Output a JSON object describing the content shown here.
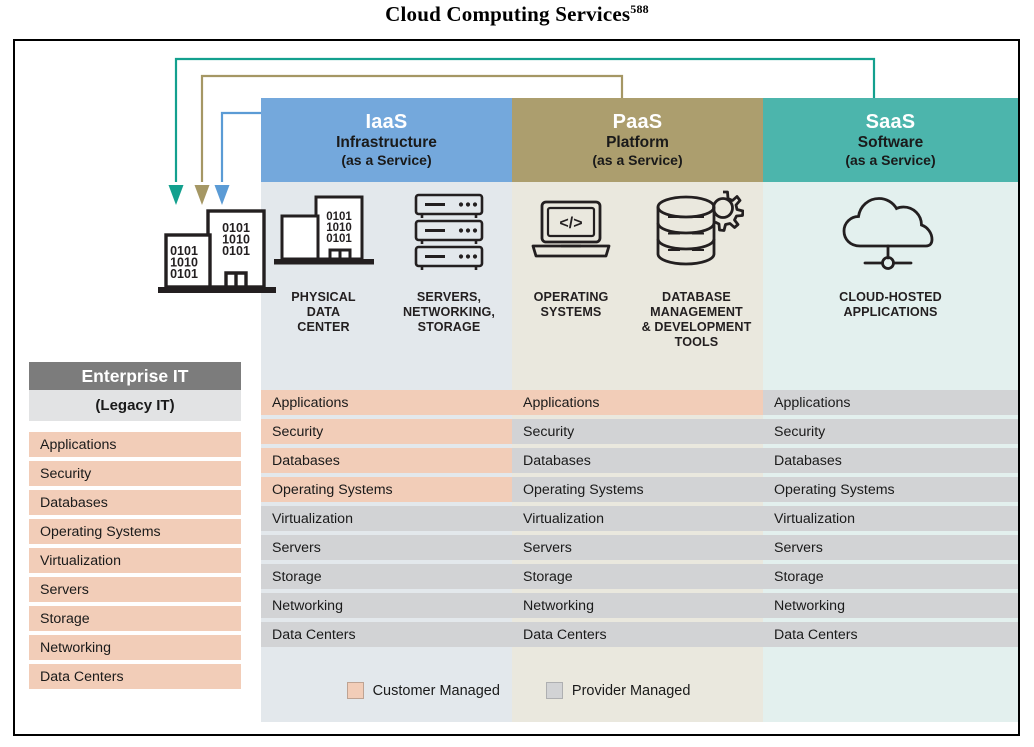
{
  "title": {
    "text": "Cloud Computing Services",
    "superscript": "588"
  },
  "legend": {
    "items": [
      {
        "label": "Customer Managed",
        "color": "#F2CDB8",
        "swatch": "customer-managed-swatch"
      },
      {
        "label": "Provider Managed",
        "color": "#D2D3D5",
        "swatch": "provider-managed-swatch"
      }
    ]
  },
  "stack_layers": [
    "Applications",
    "Security",
    "Databases",
    "Operating Systems",
    "Virtualization",
    "Servers",
    "Storage",
    "Networking",
    "Data Centers"
  ],
  "enterprise": {
    "header": "Enterprise IT",
    "subheader": "(Legacy IT)",
    "header_color": "#7C7C7C",
    "subheader_color": "#E2E3E4",
    "rows": [
      {
        "label": "Applications",
        "managed": "customer"
      },
      {
        "label": "Security",
        "managed": "customer"
      },
      {
        "label": "Databases",
        "managed": "customer"
      },
      {
        "label": "Operating Systems",
        "managed": "customer"
      },
      {
        "label": "Virtualization",
        "managed": "customer"
      },
      {
        "label": "Servers",
        "managed": "customer"
      },
      {
        "label": "Storage",
        "managed": "customer"
      },
      {
        "label": "Networking",
        "managed": "customer"
      },
      {
        "label": "Data Centers",
        "managed": "customer"
      }
    ]
  },
  "columns": [
    {
      "abbr": "IaaS",
      "name": "Infrastructure",
      "service": "(as a Service)",
      "header_color": "#74A8DC",
      "body_color": "#E3E8EC",
      "arrow_color": "#5B9BD5",
      "icons": [
        {
          "caption": "PHYSICAL\nDATA\nCENTER",
          "icon": "data-center-icon"
        },
        {
          "caption": "SERVERS,\nNETWORKING,\nSTORAGE",
          "icon": "server-stack-icon"
        }
      ],
      "rows": [
        {
          "label": "Applications",
          "managed": "customer"
        },
        {
          "label": "Security",
          "managed": "customer"
        },
        {
          "label": "Databases",
          "managed": "customer"
        },
        {
          "label": "Operating Systems",
          "managed": "customer"
        },
        {
          "label": "Virtualization",
          "managed": "provider"
        },
        {
          "label": "Servers",
          "managed": "provider"
        },
        {
          "label": "Storage",
          "managed": "provider"
        },
        {
          "label": "Networking",
          "managed": "provider"
        },
        {
          "label": "Data Centers",
          "managed": "provider"
        }
      ]
    },
    {
      "abbr": "PaaS",
      "name": "Platform",
      "service": "(as a Service)",
      "header_color": "#AC9E6E",
      "body_color": "#EAE8DE",
      "arrow_color": "#A59764",
      "icons": [
        {
          "caption": "OPERATING\nSYSTEMS",
          "icon": "laptop-code-icon"
        },
        {
          "caption": "DATABASE\nMANAGEMENT\n& DEVELOPMENT\nTOOLS",
          "icon": "database-gear-icon"
        }
      ],
      "rows": [
        {
          "label": "Applications",
          "managed": "customer"
        },
        {
          "label": "Security",
          "managed": "provider"
        },
        {
          "label": "Databases",
          "managed": "provider"
        },
        {
          "label": "Operating Systems",
          "managed": "provider"
        },
        {
          "label": "Virtualization",
          "managed": "provider"
        },
        {
          "label": "Servers",
          "managed": "provider"
        },
        {
          "label": "Storage",
          "managed": "provider"
        },
        {
          "label": "Networking",
          "managed": "provider"
        },
        {
          "label": "Data Centers",
          "managed": "provider"
        }
      ]
    },
    {
      "abbr": "SaaS",
      "name": "Software",
      "service": "(as a Service)",
      "header_color": "#4CB5AC",
      "body_color": "#E3F0EE",
      "arrow_color": "#13A08E",
      "icons": [
        {
          "caption": "CLOUD-HOSTED\nAPPLICATIONS",
          "icon": "cloud-network-icon"
        }
      ],
      "rows": [
        {
          "label": "Applications",
          "managed": "provider"
        },
        {
          "label": "Security",
          "managed": "provider"
        },
        {
          "label": "Databases",
          "managed": "provider"
        },
        {
          "label": "Operating Systems",
          "managed": "provider"
        },
        {
          "label": "Virtualization",
          "managed": "provider"
        },
        {
          "label": "Servers",
          "managed": "provider"
        },
        {
          "label": "Storage",
          "managed": "provider"
        },
        {
          "label": "Networking",
          "managed": "provider"
        },
        {
          "label": "Data Centers",
          "managed": "provider"
        }
      ]
    }
  ],
  "enterprise_icon": {
    "icon": "legacy-datacenter-icon",
    "binary_lines": [
      "0101",
      "1010",
      "0101"
    ]
  }
}
